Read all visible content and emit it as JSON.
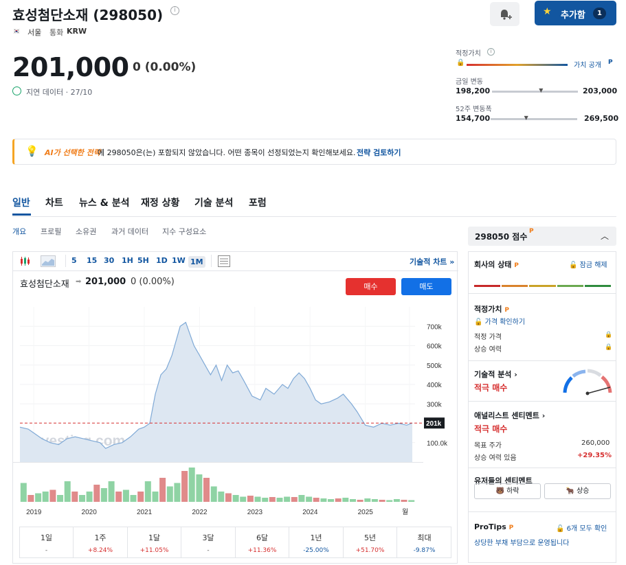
{
  "header": {
    "title": "효성첨단소재 (298050)",
    "exchange": "서울",
    "currency_label": "통화",
    "currency": "KRW",
    "add_button": {
      "label": "추가함",
      "count": "1"
    }
  },
  "quote": {
    "price": "201,000",
    "change": "0 (0.00%)",
    "delayed_note": "지연 데이터 · 27/10"
  },
  "ranges": {
    "fair_value": {
      "label": "적정가치",
      "link": "가치 공개"
    },
    "day": {
      "label": "금일 변동",
      "low": "198,200",
      "high": "203,000",
      "position": 0.57
    },
    "week52": {
      "label": "52주 변동폭",
      "low": "154,700",
      "high": "269,500",
      "position": 0.41
    }
  },
  "banner": {
    "ai_text": "AI가 선택한 전략",
    "text": "에 298050은(는) 포함되지 않았습니다. 어떤 종목이 선정되었는지 확인해보세요.",
    "link": "전략 검토하기"
  },
  "tabs": [
    "일반",
    "차트",
    "뉴스 & 분석",
    "재정 상황",
    "기술 분석",
    "포럼"
  ],
  "subtabs": [
    "개요",
    "프로필",
    "소유권",
    "과거 데이터",
    "지수 구성요소"
  ],
  "chart": {
    "timeframes": [
      "5",
      "15",
      "30",
      "1H",
      "5H",
      "1D",
      "1W",
      "1M"
    ],
    "selected_timeframe": "1M",
    "tech_chart_link": "기술적 차트 »",
    "name": "효성첨단소재",
    "price": "201,000",
    "change": "0 (0.00%)",
    "buy": "매수",
    "sell": "매도",
    "watermark": "Investing.com",
    "current_label": "201k"
  },
  "chart_data": {
    "type": "area",
    "xlabel": "",
    "ylabel": "",
    "ylim": [
      0,
      800000
    ],
    "y_ticks": [
      100000,
      300000,
      400000,
      500000,
      600000,
      700000
    ],
    "y_tick_labels": [
      "100.0k",
      "300k",
      "400k",
      "500k",
      "600k",
      "700k"
    ],
    "x_ticks": [
      2019,
      2020,
      2021,
      2022,
      2023,
      2024,
      2025,
      2025.8
    ],
    "x_tick_labels": [
      "2019",
      "2020",
      "2021",
      "2022",
      "2023",
      "2024",
      "2025",
      "월"
    ],
    "reference_line": 201000,
    "series": [
      {
        "x": [
          2018.75,
          2018.9,
          2019.0,
          2019.15,
          2019.3,
          2019.45,
          2019.6,
          2019.75,
          2019.9,
          2020.05,
          2020.2,
          2020.3,
          2020.45,
          2020.6,
          2020.75,
          2020.9,
          2021.0,
          2021.1,
          2021.2,
          2021.3,
          2021.4,
          2021.5,
          2021.6,
          2021.65,
          2021.75,
          2021.9,
          2022.0,
          2022.1,
          2022.2,
          2022.3,
          2022.4,
          2022.5,
          2022.6,
          2022.7,
          2022.8,
          2022.95,
          2023.1,
          2023.2,
          2023.35,
          2023.5,
          2023.6,
          2023.7,
          2023.8,
          2023.9,
          2024.0,
          2024.1,
          2024.2,
          2024.35,
          2024.5,
          2024.6,
          2024.75,
          2024.85,
          2025.0,
          2025.15,
          2025.3,
          2025.45,
          2025.6,
          2025.75,
          2025.85
        ],
        "y": [
          180000,
          170000,
          150000,
          120000,
          100000,
          90000,
          120000,
          130000,
          120000,
          110000,
          100000,
          70000,
          90000,
          100000,
          130000,
          170000,
          180000,
          200000,
          350000,
          450000,
          480000,
          550000,
          650000,
          700000,
          720000,
          600000,
          550000,
          500000,
          450000,
          500000,
          420000,
          500000,
          460000,
          470000,
          420000,
          340000,
          320000,
          380000,
          350000,
          400000,
          380000,
          430000,
          460000,
          430000,
          380000,
          320000,
          300000,
          310000,
          330000,
          350000,
          300000,
          260000,
          190000,
          180000,
          200000,
          190000,
          200000,
          190000,
          201000
        ]
      }
    ],
    "volume": [
      55,
      20,
      25,
      30,
      35,
      20,
      60,
      30,
      20,
      30,
      50,
      40,
      60,
      30,
      35,
      20,
      30,
      60,
      30,
      70,
      45,
      55,
      90,
      100,
      80,
      70,
      45,
      30,
      25,
      20,
      15,
      18,
      15,
      12,
      14,
      12,
      15,
      14,
      20,
      15,
      12,
      10,
      8,
      10,
      12,
      8,
      6,
      10,
      8,
      6,
      5,
      8,
      6,
      5
    ]
  },
  "performance": [
    {
      "label": "1일",
      "value": "-"
    },
    {
      "label": "1주",
      "value": "+8.24%"
    },
    {
      "label": "1달",
      "value": "+11.05%"
    },
    {
      "label": "3달",
      "value": "-"
    },
    {
      "label": "6달",
      "value": "+11.36%"
    },
    {
      "label": "1년",
      "value": "-25.00%"
    },
    {
      "label": "5년",
      "value": "+51.70%"
    },
    {
      "label": "최대",
      "value": "-9.87%"
    }
  ],
  "sidebar": {
    "score_title": "298050 점수",
    "company_health": {
      "label": "회사의 상태",
      "link": "잠금 해제"
    },
    "fair_value": {
      "label": "적정가치",
      "link": "가격 확인하기",
      "items": [
        "적정 가격",
        "상승 여력"
      ]
    },
    "technical": {
      "label": "기술적 분석",
      "verdict": "적극 매수"
    },
    "analyst": {
      "label": "애널리스트 센티멘트",
      "verdict": "적극 매수",
      "target_label": "목표 주가",
      "target_value": "260,000",
      "upside_label": "상승 여력 있음",
      "upside_value": "+29.35%"
    },
    "users": {
      "label": "유저들의 센티멘트",
      "bearish": "하락",
      "bullish": "상승"
    },
    "protips": {
      "label": "ProTips",
      "link": "6개 모두 확인",
      "tip": "상당한 부채 부담으로 운영됩니다"
    }
  },
  "colors": {
    "brand": "#1256a0",
    "buy": "#e5312f",
    "sell": "#1270e6",
    "up": "#d62f2f",
    "down": "#1256a0",
    "accent": "#f07d1a"
  }
}
